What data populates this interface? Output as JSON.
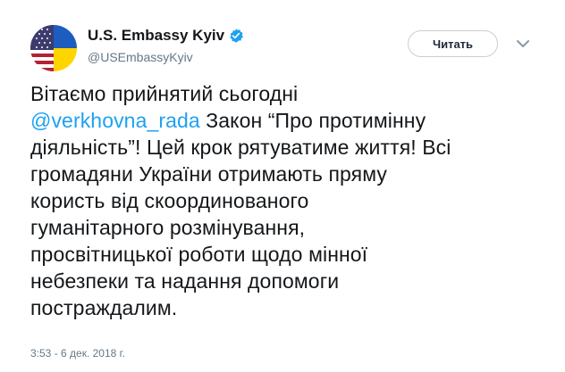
{
  "author": {
    "display_name": "U.S. Embassy Kyiv",
    "handle": "@USEmbassyKyiv",
    "verified": true,
    "avatar_icon": "us-ukraine-flag-avatar"
  },
  "header": {
    "follow_label": "Читать",
    "menu_icon": "chevron-down-icon"
  },
  "tweet": {
    "line1": "Вітаємо прийнятий сьогодні",
    "mention": "@verkhovna_rada",
    "line2_rest": " Закон “Про протимінну",
    "line3": "діяльність”! Цей крок рятуватиме життя! Всі",
    "line4": "громадяни України отримають пряму",
    "line5": "користь від скоординованого",
    "line6": "гуманітарного розмінування,",
    "line7": "просвітницької роботи щодо мінної",
    "line8": "небезпеки та надання допомоги",
    "line9": "постраждалим."
  },
  "meta": {
    "timestamp": "3:53 - 6 дек. 2018 г."
  },
  "colors": {
    "mention": "#1da1f2",
    "verified": "#1da1f2",
    "muted": "#657786"
  }
}
